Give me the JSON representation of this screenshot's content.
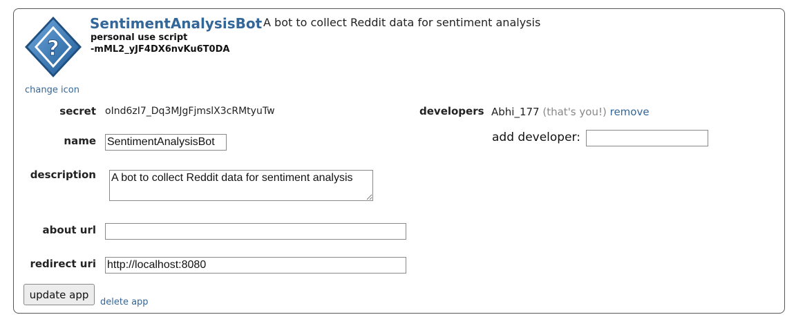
{
  "app": {
    "name": "SentimentAnalysisBot",
    "description": "A bot to collect Reddit data for sentiment analysis",
    "type": "personal use script",
    "client_id": "-mML2_yJF4DX6nvKu6T0DA",
    "change_icon": "change icon",
    "icon": "question-mark-diamond-icon"
  },
  "fields": {
    "secret_label": "secret",
    "secret_value": "oInd6zI7_Dq3MJgFjmslX3cRMtyuTw",
    "name_label": "name",
    "name_value": "SentimentAnalysisBot",
    "description_label": "description",
    "description_value": "A bot to collect Reddit data for sentiment analysis",
    "about_url_label": "about url",
    "about_url_value": "",
    "redirect_uri_label": "redirect uri",
    "redirect_uri_value": "http://localhost:8080"
  },
  "developers": {
    "label": "developers",
    "user": "Abhi_177",
    "you_note": "(that's you!)",
    "remove": "remove",
    "add_label": "add developer:",
    "add_value": ""
  },
  "actions": {
    "update": "update app",
    "delete": "delete app"
  },
  "colors": {
    "link": "#336699",
    "icon_fill": "#3d7fc1",
    "muted": "#888888"
  }
}
